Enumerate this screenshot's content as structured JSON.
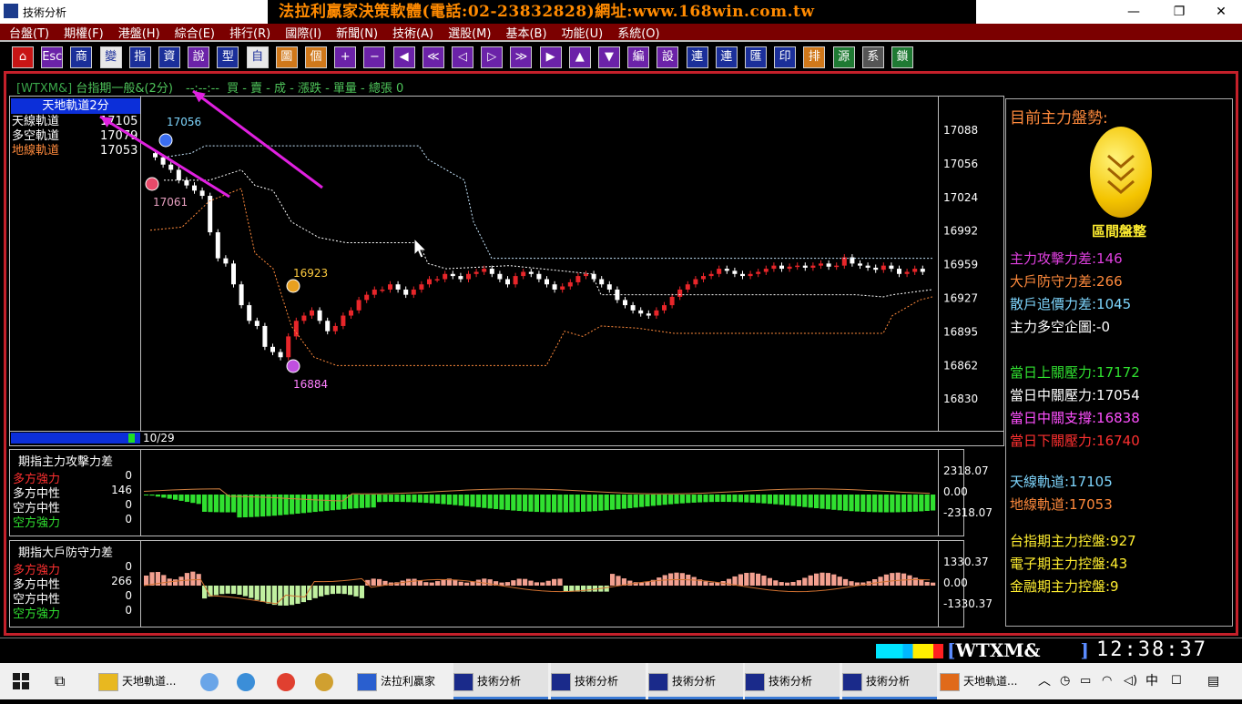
{
  "window": {
    "title": "技術分析",
    "banner": "法拉利贏家決策軟體(電話:02-23832828)網址:www.168win.com.tw",
    "min": "—",
    "max": "❐",
    "close": "✕"
  },
  "menu": [
    "台盤(T)",
    "期權(F)",
    "港盤(H)",
    "綜合(E)",
    "排行(R)",
    "國際(I)",
    "新聞(N)",
    "技術(A)",
    "選股(M)",
    "基本(B)",
    "功能(U)",
    "系統(O)"
  ],
  "toolbar": [
    "⌂",
    "Esc",
    "商",
    "變",
    "指",
    "資",
    "說",
    "型",
    "自",
    "圖",
    "個",
    "+",
    "−",
    "◀",
    "≪",
    "◁",
    "▷",
    "≫",
    "▶",
    "▲",
    "▼",
    "編",
    "設",
    "連",
    "連",
    "匯",
    "印",
    "排",
    "源",
    "系",
    "鎖"
  ],
  "infobar": {
    "symbol": "[WTXM&]",
    "name": "台指期一般&(2分)",
    "time": "--:--:--",
    "fields": "買 - 賣 - 成 - 漲跌 - 單量 - 總張 0"
  },
  "main": {
    "legend_title": "天地軌道2分",
    "legend": [
      {
        "label": "天線軌道",
        "value": "17105",
        "color": "#ffffff"
      },
      {
        "label": "多空軌道",
        "value": "17079",
        "color": "#ffffff"
      },
      {
        "label": "地線軌道",
        "value": "17053",
        "color": "#ff8a3c"
      }
    ],
    "y_ticks": [
      "17088",
      "17056",
      "17024",
      "16992",
      "16959",
      "16927",
      "16895",
      "16862",
      "16830"
    ],
    "annotations": {
      "high_label": "17056",
      "left_label": "17061",
      "mid_label": "16923",
      "low_label": "16884"
    },
    "date_label": "10/29"
  },
  "osc1": {
    "title": "期指主力攻擊力差",
    "rows": [
      {
        "label": "多方強力",
        "value": "0",
        "color": "#ff3030"
      },
      {
        "label": "多方中性",
        "value": "146",
        "color": "#ffffff"
      },
      {
        "label": "空方中性",
        "value": "0",
        "color": "#ffffff"
      },
      {
        "label": "空方強力",
        "value": "0",
        "color": "#30e030"
      }
    ],
    "ticks": [
      "2318.07",
      "0.00",
      "-2318.07"
    ]
  },
  "osc2": {
    "title": "期指大戶防守力差",
    "rows": [
      {
        "label": "多方強力",
        "value": "0",
        "color": "#ff3030"
      },
      {
        "label": "多方中性",
        "value": "266",
        "color": "#ffffff"
      },
      {
        "label": "空方中性",
        "value": "0",
        "color": "#ffffff"
      },
      {
        "label": "空方強力",
        "value": "0",
        "color": "#30e030"
      }
    ],
    "ticks": [
      "1330.37",
      "0.00",
      "-1330.37"
    ]
  },
  "right": {
    "header": "目前主力盤勢:",
    "badge": "區間盤整",
    "lines": [
      {
        "text": "主力攻擊力差:146",
        "color": "#e040e0"
      },
      {
        "text": "大戶防守力差:266",
        "color": "#ff8a3c"
      },
      {
        "text": "散戶追價力差:1045",
        "color": "#7fd7ff"
      },
      {
        "text": "主力多空企圖:-0",
        "color": "#ffffff"
      },
      {
        "text": "當日上關壓力:17172",
        "color": "#30e030"
      },
      {
        "text": "當日中關壓力:17054",
        "color": "#ffffff"
      },
      {
        "text": "當日中關支撐:16838",
        "color": "#ff50ff"
      },
      {
        "text": "當日下關壓力:16740",
        "color": "#ff3030"
      },
      {
        "text": "天線軌道:17105",
        "color": "#7fd7ff"
      },
      {
        "text": "地線軌道:17053",
        "color": "#ff8a3c"
      },
      {
        "text": "台指期主力控盤:927",
        "color": "#ffee30"
      },
      {
        "text": "電子期主力控盤:43",
        "color": "#ffee30"
      },
      {
        "text": "金融期主力控盤:9",
        "color": "#ffee30"
      }
    ]
  },
  "status": {
    "symbol": "WTXM&",
    "clock": "12:38:37"
  },
  "taskbar": {
    "items": [
      "天地軌道...",
      "法拉利贏家",
      "技術分析",
      "技術分析",
      "技術分析",
      "技術分析",
      "技術分析",
      "天地軌道..."
    ],
    "ime": "中"
  }
}
